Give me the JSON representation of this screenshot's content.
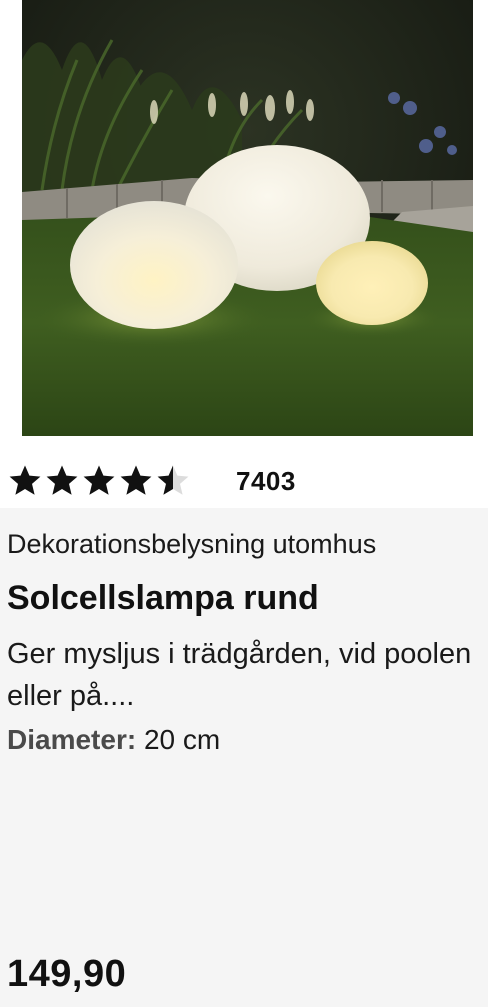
{
  "product": {
    "image": {
      "alt": "",
      "colors": {
        "sky": "#1d2218",
        "grass": "#3d5a1f",
        "edging": "#8f8b82",
        "lamp_glow": "#fff2c0"
      }
    },
    "rating": {
      "value": 4.5,
      "max": 5,
      "count": "7403",
      "star_icon": "star-icon",
      "star_color": "#111111",
      "empty_color": "#dcdcdc"
    },
    "category": "Dekorationsbelysning utomhus",
    "title": "Solcellslampa rund",
    "description": "Ger mysljus i trädgården, vid poolen eller på....",
    "attribute": {
      "label": "Diameter:",
      "value": "20 cm"
    },
    "price": "149,90"
  }
}
